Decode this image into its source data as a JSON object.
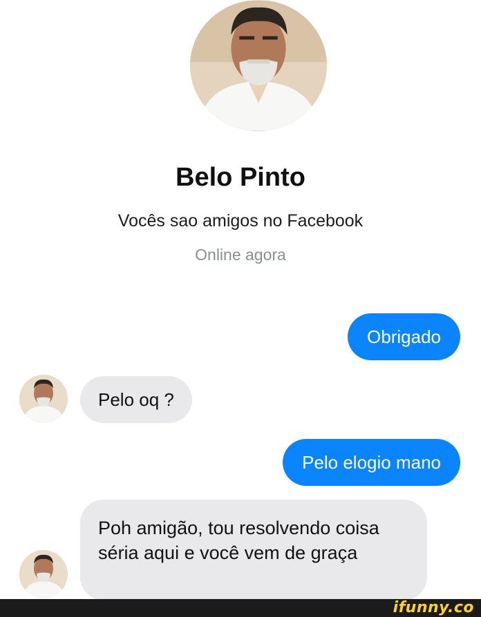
{
  "contact": {
    "name": "Belo Pinto",
    "relation": "Vocês sao amigos no Facebook",
    "status": "Online agora"
  },
  "messages": [
    {
      "direction": "outgoing",
      "text": "Obrigado"
    },
    {
      "direction": "incoming",
      "text": "Pelo oq ?"
    },
    {
      "direction": "outgoing",
      "text": "Pelo elogio mano"
    },
    {
      "direction": "incoming",
      "text": "Poh amigão, tou resolvendo coisa séria aqui e você vem de graça"
    }
  ],
  "watermark": "ifunny.co",
  "colors": {
    "outgoing_bubble": "#0a84ff",
    "incoming_bubble": "#e9e9eb",
    "watermark": "#ffd31a"
  }
}
